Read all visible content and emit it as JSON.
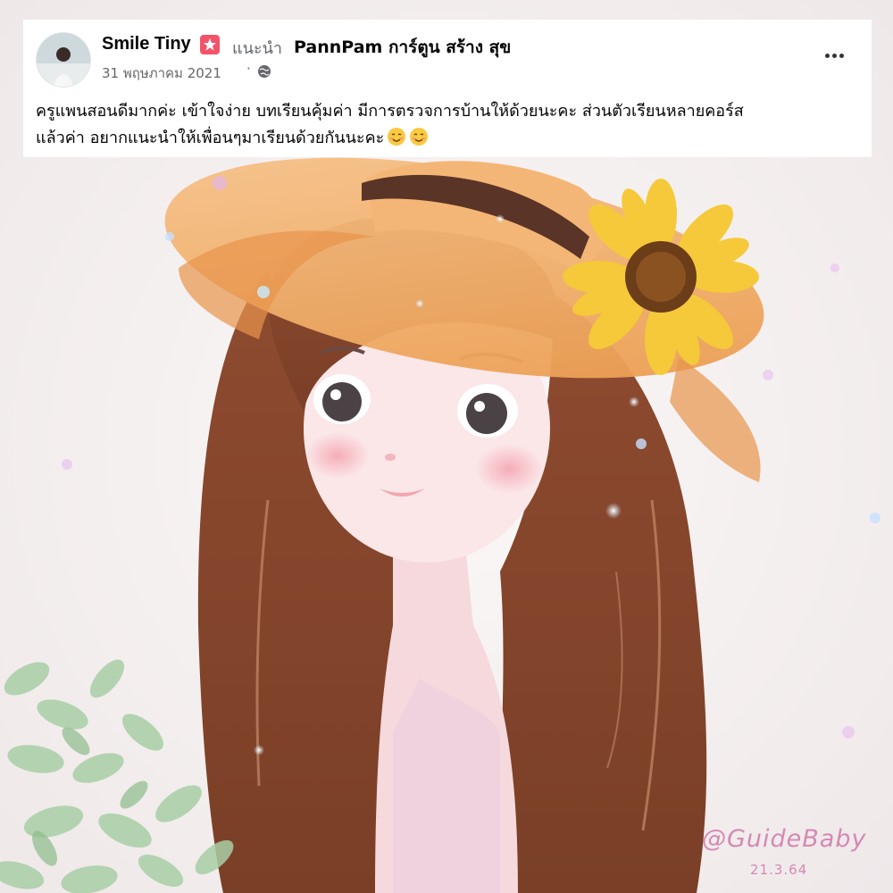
{
  "post": {
    "author": "Smile Tiny",
    "recommends_label": "แนะนำ",
    "page_name": "PannPam การ์ตูน สร้าง สุข",
    "date": "31 พฤษภาคม 2021",
    "separator": "·",
    "privacy_icon": "globe-icon",
    "text_line1": "ครูแพนสอนดีมากค่ะ เข้าใจง่าย บทเรียนคุ้มค่า มีการตรวจการบ้านให้ด้วยนะคะ ส่วนตัวเรียนหลายคอร์ส",
    "text_line2": "แล้วค่า อยากแนะนำให้เพื่อนๆมาเรียนด้วยกันนะคะ",
    "emojis": [
      "smiling-face-emoji",
      "smiling-face-emoji"
    ],
    "more_icon": "more-options-icon"
  },
  "artwork": {
    "signature": "@GuideBaby",
    "signature_date": "21.3.64"
  },
  "colors": {
    "background": "#f6f1f1",
    "hair": "#8a4a2e",
    "hat": "#f0b172",
    "sunflower": "#f5c93a",
    "recommend_badge": "#f35369",
    "signature": "#d48ab4"
  }
}
